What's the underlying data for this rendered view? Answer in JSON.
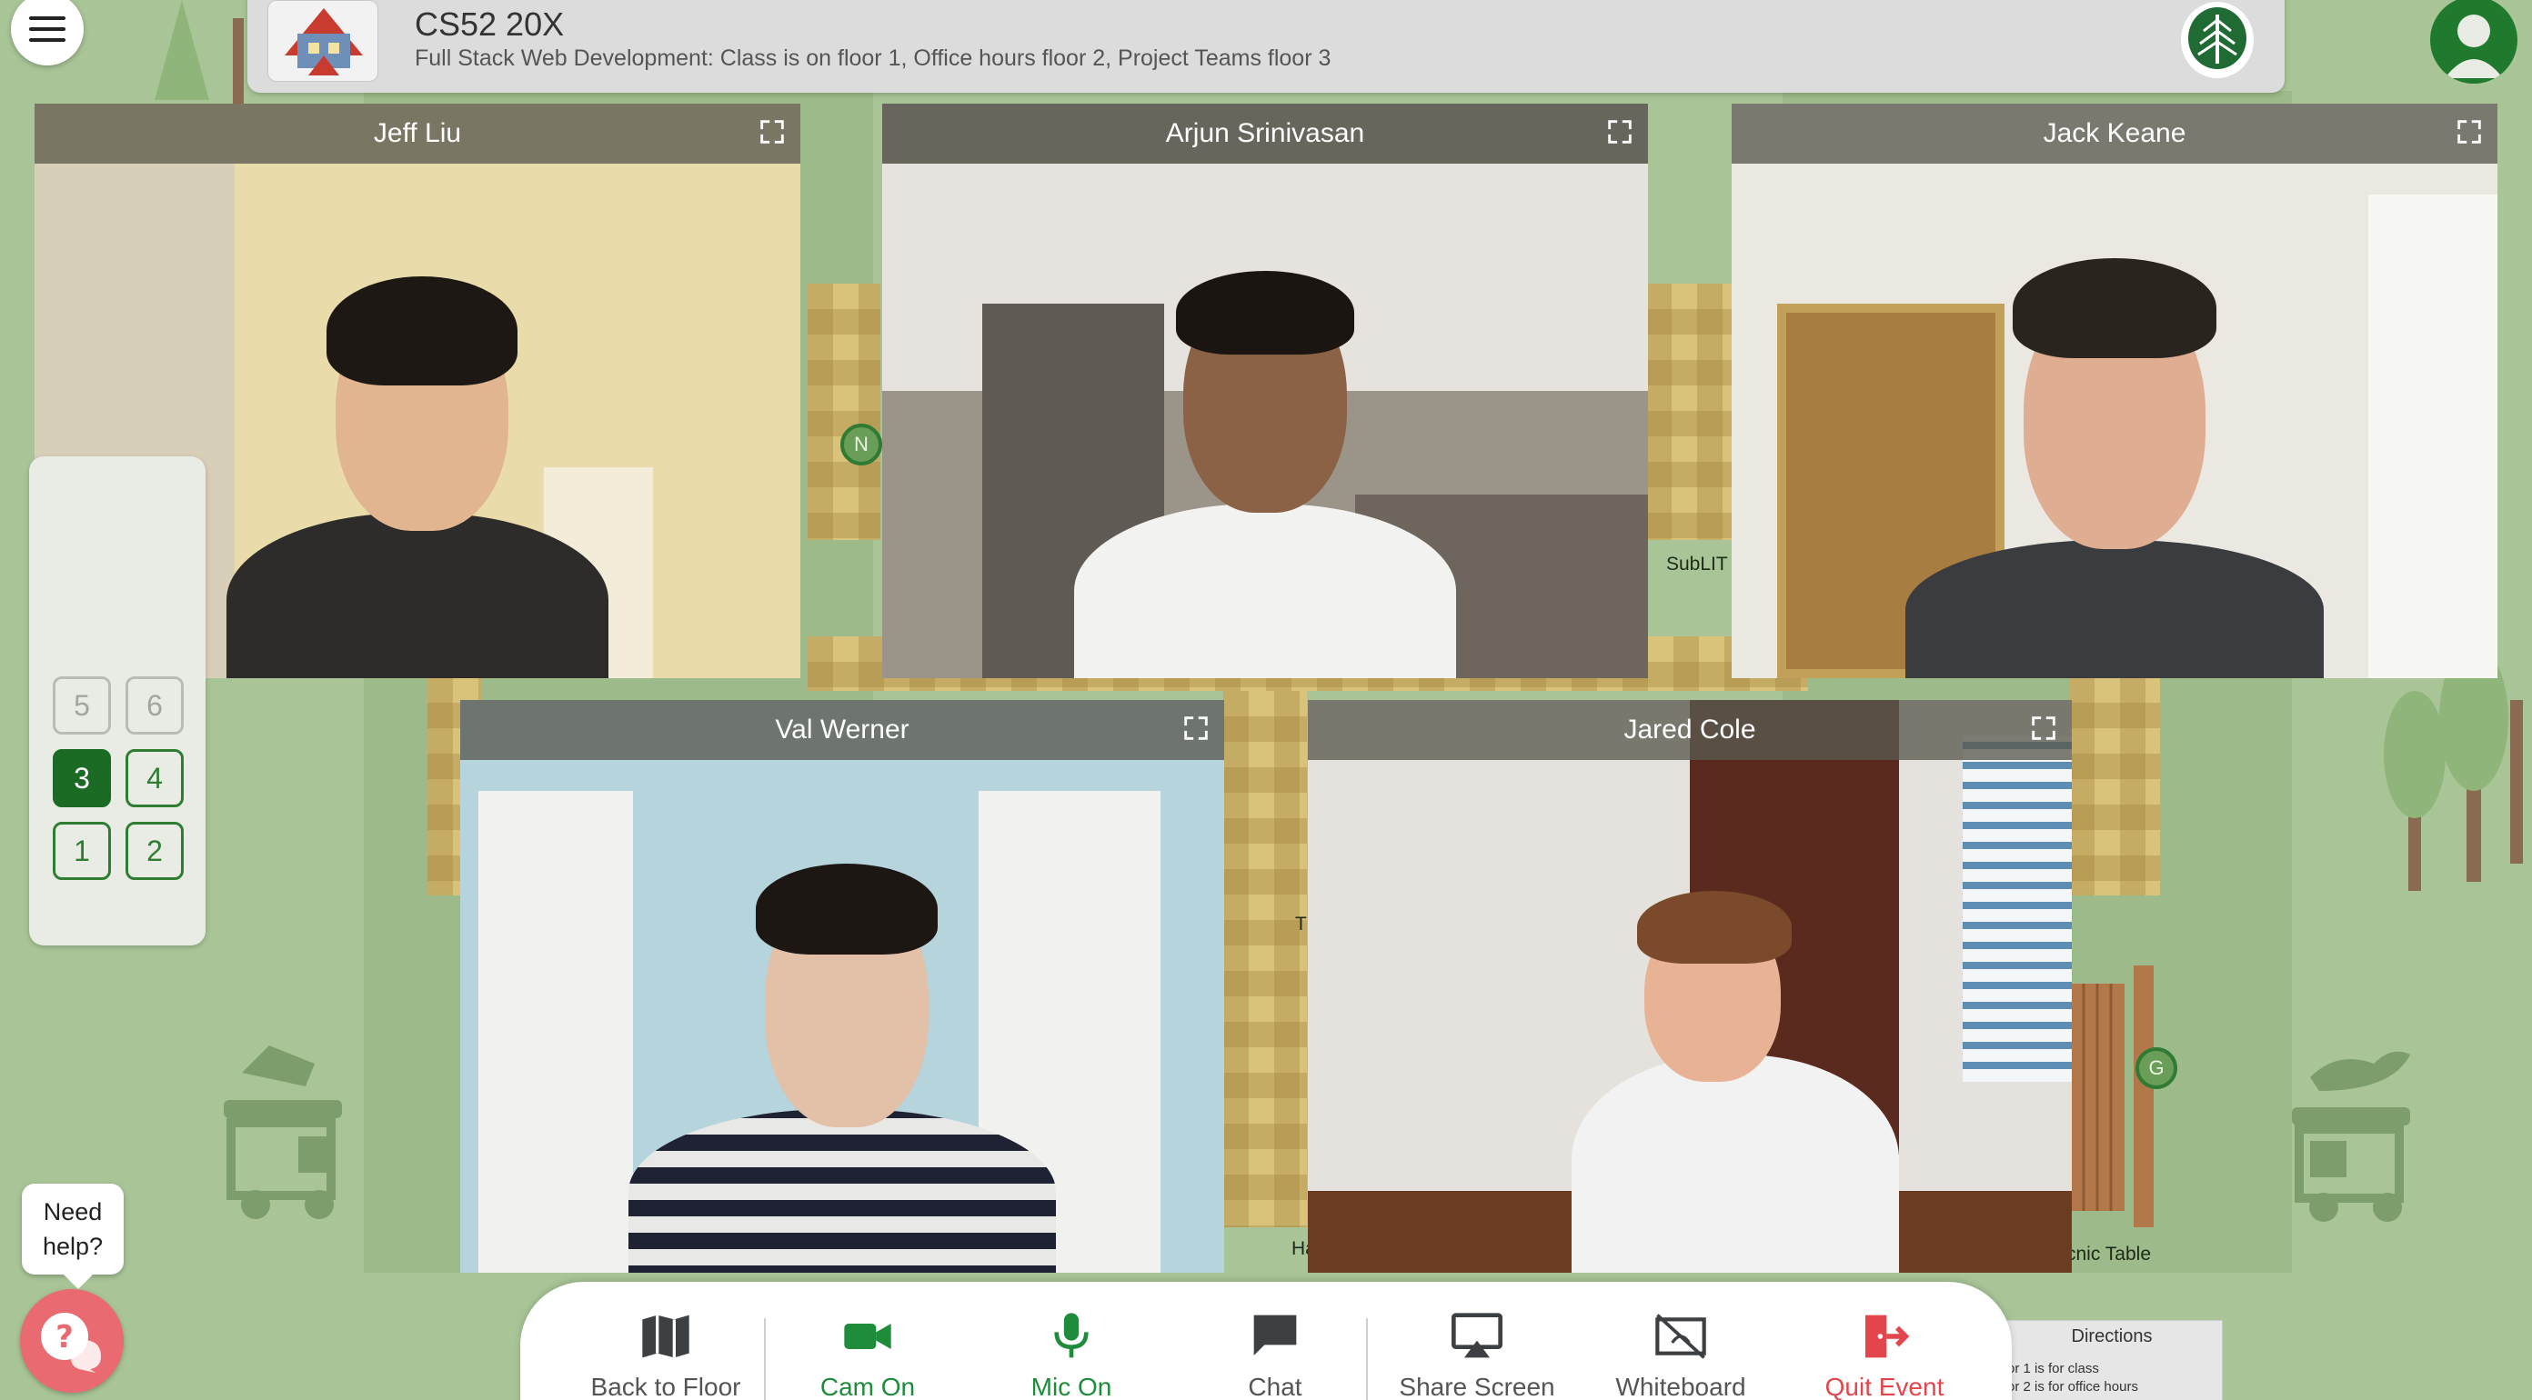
{
  "event": {
    "title": "CS52 20X",
    "description": "Full Stack Web Development: Class is on floor 1, Office hours floor 2, Project Teams floor 3"
  },
  "participants": [
    {
      "name": "Jeff Liu"
    },
    {
      "name": "Arjun Srinivasan"
    },
    {
      "name": "Jack Keane"
    },
    {
      "name": "Val Werner"
    },
    {
      "name": "Jared Cole"
    }
  ],
  "map": {
    "labels": {
      "sublit": "SubLIT",
      "t_fragment": "T",
      "ha_fragment": "Ha",
      "picnic": "cnic Table"
    },
    "pins": {
      "n": "N",
      "g": "G"
    }
  },
  "elevator": {
    "floors": [
      {
        "label": "5",
        "state": "disabled"
      },
      {
        "label": "6",
        "state": "disabled"
      },
      {
        "label": "3",
        "state": "current"
      },
      {
        "label": "4",
        "state": "enabled"
      },
      {
        "label": "1",
        "state": "enabled"
      },
      {
        "label": "2",
        "state": "enabled"
      }
    ]
  },
  "help": {
    "text_line1": "Need",
    "text_line2": "help?"
  },
  "toolbar": {
    "back_to_floor": "Back to Floor",
    "cam_on": "Cam On",
    "mic_on": "Mic On",
    "chat": "Chat",
    "share_screen": "Share Screen",
    "whiteboard": "Whiteboard",
    "quit_event": "Quit Event"
  },
  "directions": {
    "title": "Directions",
    "line1": "or 1 is for class",
    "line2": "or 2 is for office hours"
  },
  "colors": {
    "background": "#a9c597",
    "accent_green": "#1e8c3a",
    "quit_red": "#e2464c",
    "help_pink": "#e96a70"
  }
}
